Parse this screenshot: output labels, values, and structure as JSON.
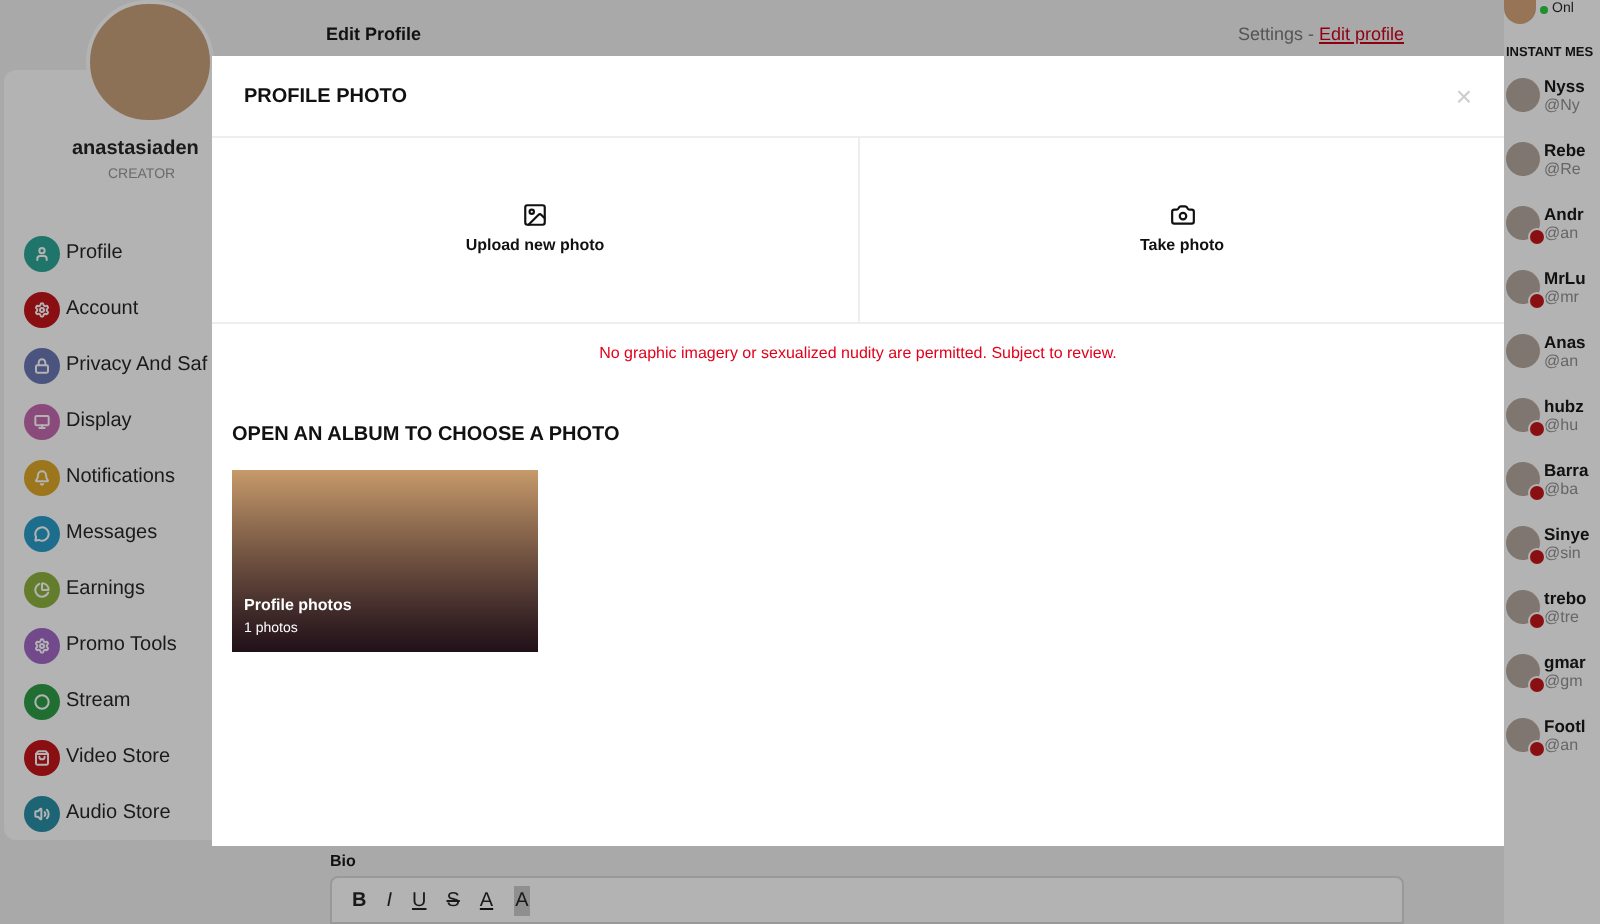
{
  "profile": {
    "username": "anastasiaden",
    "role": "CREATOR"
  },
  "menu": [
    {
      "label": "Profile",
      "color": "#20756b"
    },
    {
      "label": "Account",
      "color": "#890f13"
    },
    {
      "label": "Privacy And Saf",
      "color": "#4a547e"
    },
    {
      "label": "Display",
      "color": "#8a4a7b"
    },
    {
      "label": "Notifications",
      "color": "#9c761d"
    },
    {
      "label": "Messages",
      "color": "#1d6d8c"
    },
    {
      "label": "Earnings",
      "color": "#647d2c"
    },
    {
      "label": "Promo Tools",
      "color": "#724a8c"
    },
    {
      "label": "Stream",
      "color": "#206e31"
    },
    {
      "label": "Video Store",
      "color": "#890f13"
    },
    {
      "label": "Audio Store",
      "color": "#1d6475"
    }
  ],
  "header": {
    "title": "Edit Profile",
    "breadcrumb": "Settings - ",
    "breadcrumb_link": "Edit profile"
  },
  "bio": {
    "label": "Bio",
    "toolbar": [
      {
        "label": "B",
        "kind": "bold"
      },
      {
        "label": "I",
        "kind": "italic"
      },
      {
        "label": "U",
        "kind": "underline"
      },
      {
        "label": "S",
        "kind": "strike"
      },
      {
        "label": "A",
        "kind": "color"
      },
      {
        "label": "A",
        "kind": "highlight"
      }
    ]
  },
  "right_sidebar": {
    "status": "Onl",
    "section_title": "INSTANT MES",
    "contacts": [
      {
        "name": "Nyss",
        "handle": "@Ny",
        "badge": false
      },
      {
        "name": "Rebe",
        "handle": "@Re",
        "badge": false
      },
      {
        "name": "Andr",
        "handle": "@an",
        "badge": true
      },
      {
        "name": "MrLu",
        "handle": "@mr",
        "badge": true
      },
      {
        "name": "Anas",
        "handle": "@an",
        "badge": false
      },
      {
        "name": "hubz",
        "handle": "@hu",
        "badge": true
      },
      {
        "name": "Barra",
        "handle": "@ba",
        "badge": true
      },
      {
        "name": "Sinye",
        "handle": "@sin",
        "badge": true
      },
      {
        "name": "trebo",
        "handle": "@tre",
        "badge": true
      },
      {
        "name": "gmar",
        "handle": "@gm",
        "badge": true
      },
      {
        "name": "Footl",
        "handle": "@an",
        "badge": true
      }
    ]
  },
  "modal": {
    "title": "PROFILE PHOTO",
    "close": "×",
    "options": [
      {
        "label": "Upload new photo",
        "kind": "upload"
      },
      {
        "label": "Take photo",
        "kind": "camera"
      }
    ],
    "warning": "No graphic imagery or sexualized nudity are permitted. Subject to review.",
    "albums_title": "OPEN AN ALBUM TO CHOOSE A PHOTO",
    "albums": [
      {
        "name": "Profile photos",
        "count": "1 photos"
      }
    ]
  }
}
